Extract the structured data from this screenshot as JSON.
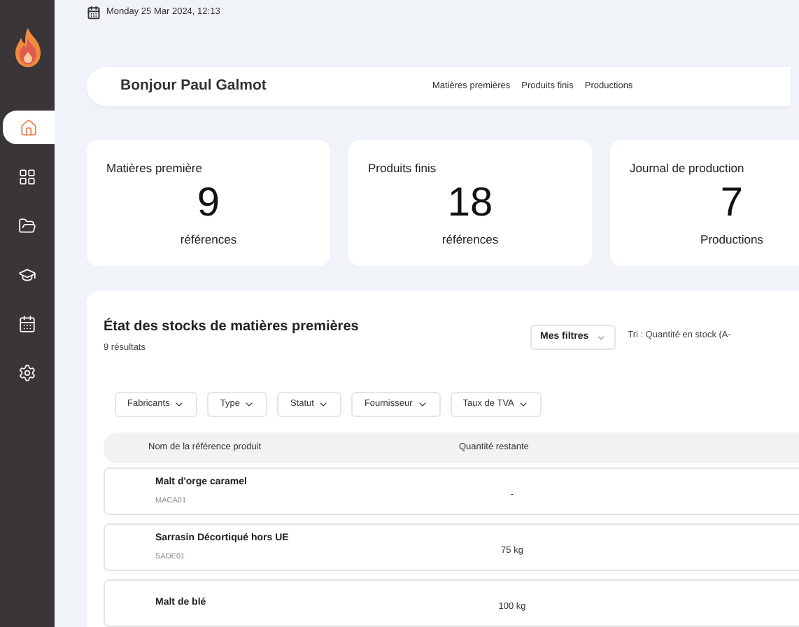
{
  "date": "Monday 25 Mar 2024, 12:13",
  "sidebar": {
    "items": [
      {
        "kind": "home",
        "selected": true
      },
      {
        "kind": "grid",
        "selected": false
      },
      {
        "kind": "folder",
        "selected": false
      },
      {
        "kind": "graduation",
        "selected": false
      },
      {
        "kind": "calendar",
        "selected": false
      },
      {
        "kind": "settings",
        "selected": false
      }
    ]
  },
  "header": {
    "greeting": "Bonjour Paul Galmot",
    "links": [
      "Matières premières",
      "Produits finis",
      "Productions"
    ]
  },
  "stats": [
    {
      "title": "Matières première",
      "value": "9",
      "unit": "références"
    },
    {
      "title": "Produits finis",
      "value": "18",
      "unit": "références"
    },
    {
      "title": "Journal de production",
      "value": "7",
      "unit": "Productions"
    }
  ],
  "stock": {
    "title": "État des stocks de matières premières",
    "count": "9 résultats",
    "filters_button": "Mes filtres",
    "sort": "Tri : Quantité en stock (A-",
    "filters": [
      "Fabricants",
      "Type",
      "Statut",
      "Fournisseur",
      "Taux de TVA"
    ],
    "columns": [
      "Nom de la référence produit",
      "Quantité restante"
    ],
    "rows": [
      {
        "name": "Malt d'orge caramel",
        "code": "MACA01",
        "quantity": "-"
      },
      {
        "name": "Sarrasin Décortiqué hors UE",
        "code": "SADE01",
        "quantity": "75 kg"
      },
      {
        "name": "Malt de blé",
        "quantity": "100 kg"
      }
    ]
  }
}
